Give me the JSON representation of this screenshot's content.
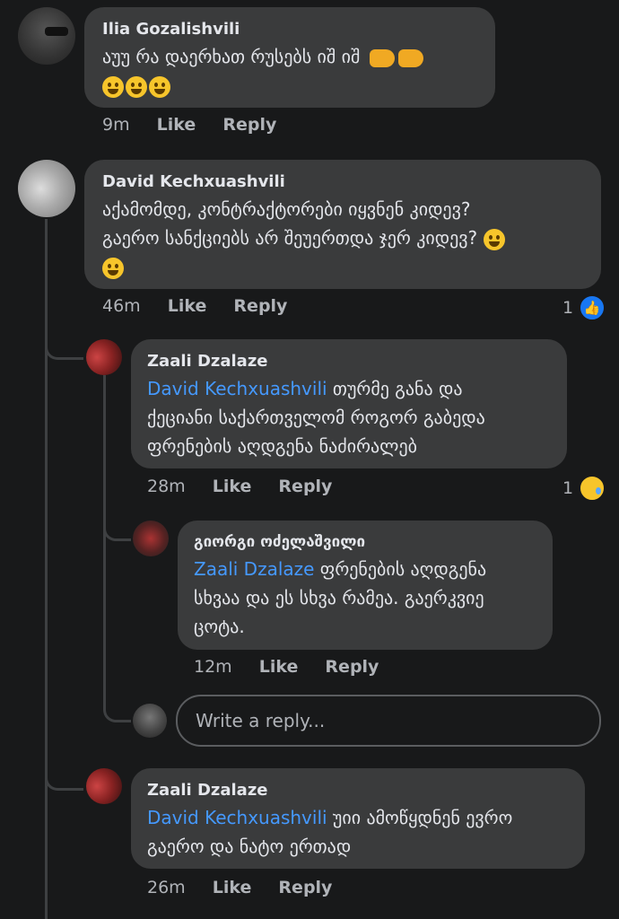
{
  "comments": [
    {
      "author": "Ilia Gozalishvili",
      "text": "აუუ რა დაერხათ რუსებს იშ იშ",
      "time": "9m",
      "like": "Like",
      "reply": "Reply"
    },
    {
      "author": "David Kechxuashvili",
      "line1": "აქამომდე, კონტრაქტორები იყვნენ კიდევ?",
      "line2": "გაერო სანქციებს არ შეუერთდა ჯერ კიდევ?",
      "time": "46m",
      "like": "Like",
      "reply": "Reply",
      "reaction_count": "1"
    },
    {
      "author": "Zaali Dzalaze",
      "mention": "David Kechxuashvili",
      "line1": " თურმე განა და",
      "line2": "ქეციანი საქართველომ როგორ გაბედა",
      "line3": "ფრენების აღდგენა ნაძირალებ",
      "time": "28m",
      "like": "Like",
      "reply": "Reply",
      "reaction_count": "1"
    },
    {
      "author": "გიორგი ოძელაშვილი",
      "mention": "Zaali Dzalaze",
      "line1": "  ფრენების აღდგენა",
      "line2": "სხვაა და ეს სხვა რამეა. გაერკვიე",
      "line3": "ცოტა.",
      "time": "12m",
      "like": "Like",
      "reply": "Reply"
    },
    {
      "author": "Zaali Dzalaze",
      "mention": "David Kechxuashvili",
      "line1": " უიი ამოწყდნენ ევრო",
      "line2": "გაერო და ნატო ერთად",
      "time": "26m",
      "like": "Like",
      "reply": "Reply"
    }
  ],
  "reply_input": {
    "placeholder": "Write a reply..."
  },
  "colors": {
    "background": "#18191a",
    "bubble": "#3a3b3c",
    "mention": "#4599ff",
    "like_badge": "#1877f2"
  },
  "icons": [
    "laughing-emoji-icon",
    "fist-emoji-icon",
    "thinking-emoji-icon",
    "smile-emoji-icon",
    "like-reaction-icon",
    "sad-reaction-icon"
  ]
}
